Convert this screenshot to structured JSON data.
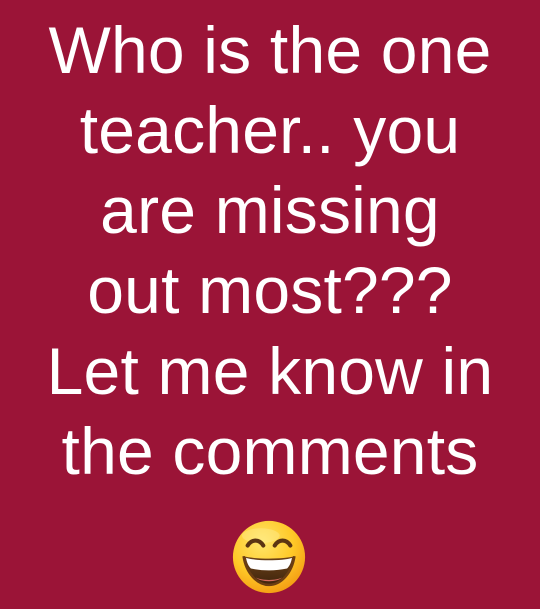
{
  "post": {
    "background_color": "#9b1437",
    "text_color": "#ffffff",
    "lines": [
      "Who is the one",
      "teacher.. you",
      "are missing",
      "out most???",
      "Let me know in",
      "the comments"
    ],
    "emoji": {
      "icon": "grinning-face-with-smiling-eyes-icon"
    }
  }
}
